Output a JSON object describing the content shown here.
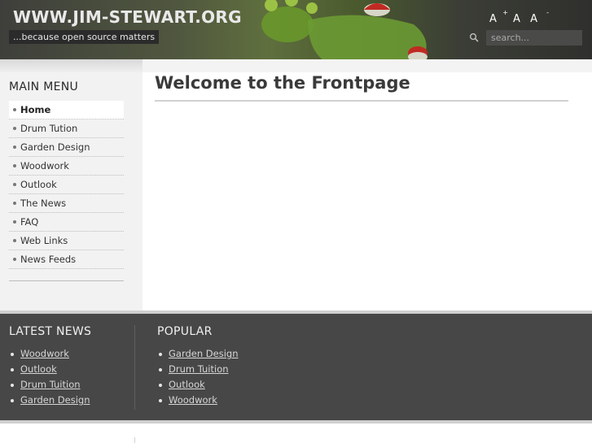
{
  "header": {
    "site_title": "WWW.JIM-STEWART.ORG",
    "tagline": "...because open source matters",
    "font_controls": {
      "increase": "A",
      "reset": "A",
      "decrease": "A",
      "plus": "+",
      "minus": "-"
    },
    "search_placeholder": "search..."
  },
  "sidebar": {
    "title": "MAIN MENU",
    "items": [
      "Home",
      "Drum Tution",
      "Garden Design",
      "Woodwork",
      "Outlook",
      "The News",
      "FAQ",
      "Web Links",
      "News Feeds"
    ],
    "active_index": 0
  },
  "main": {
    "title": "Welcome to the Frontpage"
  },
  "footer": {
    "latest_news": {
      "title": "LATEST NEWS",
      "items": [
        "Woodwork",
        "Outlook",
        "Drum Tuition",
        "Garden Design"
      ]
    },
    "popular": {
      "title": "POPULAR",
      "items": [
        "Garden Design",
        "Drum Tuition",
        "Outlook",
        "Woodwork"
      ]
    }
  },
  "icons": {
    "search": "search-icon"
  },
  "colors": {
    "header_bg": "#3e3f3b",
    "footer_bg": "#474747",
    "sidebar_bg": "#f2f2f2",
    "accent_frog": "#7dbb2f"
  }
}
